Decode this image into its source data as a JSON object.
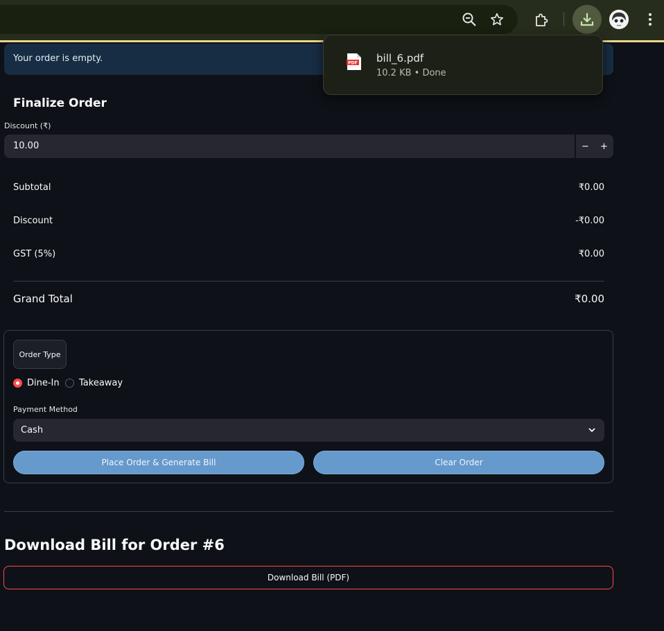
{
  "browser": {
    "toolbar_icons": [
      "zoom-out-icon",
      "bookmark-star-icon",
      "extensions-icon",
      "download-icon",
      "profile-avatar",
      "more-menu-icon"
    ]
  },
  "download_popup": {
    "file_name": "bill_6.pdf",
    "status": "10.2 KB • Done",
    "file_icon": "pdf-file-icon",
    "file_icon_text": "PDF"
  },
  "alert": {
    "message": "Your order is empty."
  },
  "finalize": {
    "title": "Finalize Order",
    "discount_label": "Discount (₹)",
    "discount_value": "10.00",
    "minus_label": "−",
    "plus_label": "+"
  },
  "summary": {
    "subtotal_label": "Subtotal",
    "subtotal_value": "₹0.00",
    "discount_label": "Discount",
    "discount_value": "-₹0.00",
    "gst_label": "GST (5%)",
    "gst_value": "₹0.00",
    "grand_label": "Grand Total",
    "grand_value": "₹0.00"
  },
  "order": {
    "order_type_label": "Order Type",
    "options": [
      "Dine-In",
      "Takeaway"
    ],
    "selected_option": "Dine-In",
    "payment_label": "Payment Method",
    "payment_value": "Cash",
    "place_button": "Place Order & Generate Bill",
    "clear_button": "Clear Order"
  },
  "download_section": {
    "heading": "Download Bill for Order #6",
    "button_label": "Download Bill (PDF)"
  },
  "colors": {
    "accent_red": "#ff4b4b",
    "primary_button": "#6699cc",
    "background": "#0e1117",
    "input_bg": "#262730",
    "info_bg": "#172d43"
  }
}
